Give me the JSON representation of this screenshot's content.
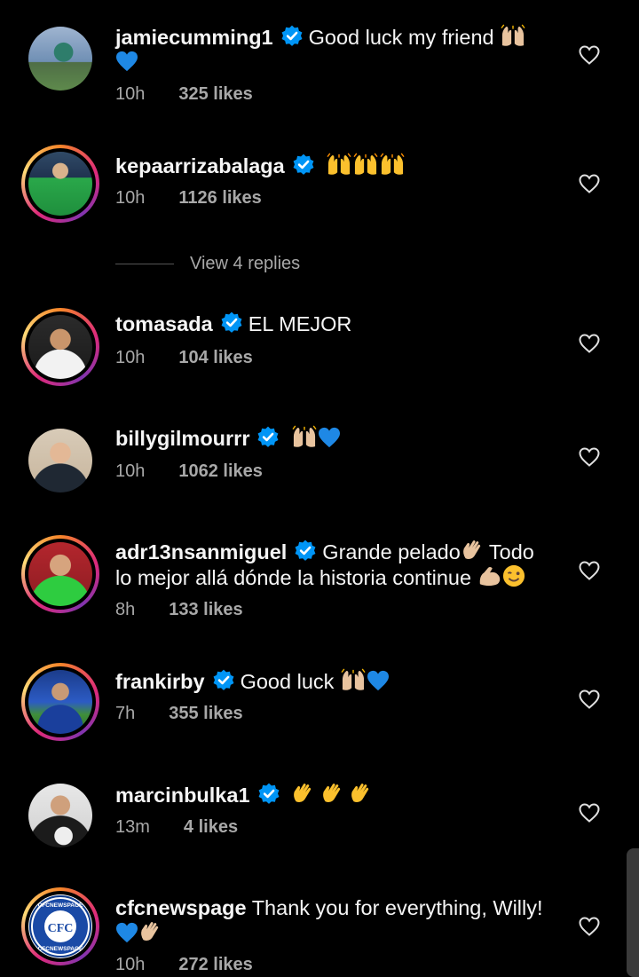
{
  "comments": [
    {
      "username": "jamiecumming1",
      "text": "Good luck my friend",
      "time": "10h",
      "likes": "325 likes",
      "emoji": [
        "raising-hands-icon",
        "blue-heart-icon"
      ]
    },
    {
      "username": "kepaarrizabalaga",
      "text": "",
      "time": "10h",
      "likes": "1126 likes",
      "emoji": [
        "raising-hands-icon",
        "raising-hands-icon",
        "raising-hands-icon"
      ]
    },
    {
      "username": "tomasada",
      "text": "EL MEJOR",
      "time": "10h",
      "likes": "104 likes",
      "emoji": []
    },
    {
      "username": "billygilmourrr",
      "text": "",
      "time": "10h",
      "likes": "1062 likes",
      "emoji": [
        "raising-hands-icon",
        "blue-heart-icon"
      ]
    },
    {
      "username": "adr13nsanmiguel",
      "text": "Grande pelado",
      "text2": "Todo",
      "text3": "lo mejor allá dónde la historia continue",
      "time": "8h",
      "likes": "133 likes",
      "emoji": [
        "waving-hand-icon",
        "flexed-biceps-icon",
        "winking-face-icon"
      ]
    },
    {
      "username": "frankirby",
      "text": "Good luck",
      "time": "7h",
      "likes": "355 likes",
      "emoji": [
        "raising-hands-icon",
        "blue-heart-icon"
      ]
    },
    {
      "username": "marcinbulka1",
      "text": "",
      "time": "13m",
      "likes": "4 likes",
      "emoji": [
        "waving-hand-icon",
        "waving-hand-icon",
        "waving-hand-icon"
      ]
    },
    {
      "username": "cfcnewspage",
      "text": "Thank you for everything, Willy!",
      "time": "10h",
      "likes": "272 likes",
      "emoji": [
        "blue-heart-icon",
        "waving-hand-icon"
      ],
      "avatar_text": "CFCNEWSPAGE",
      "avatar_text2": "CFC"
    }
  ],
  "replies_link": "View 4 replies",
  "colors": {
    "background": "#000000",
    "text": "#f5f5f5",
    "muted": "#a8a8a8",
    "verified": "#0095f6",
    "heart": "#1e88e5"
  }
}
